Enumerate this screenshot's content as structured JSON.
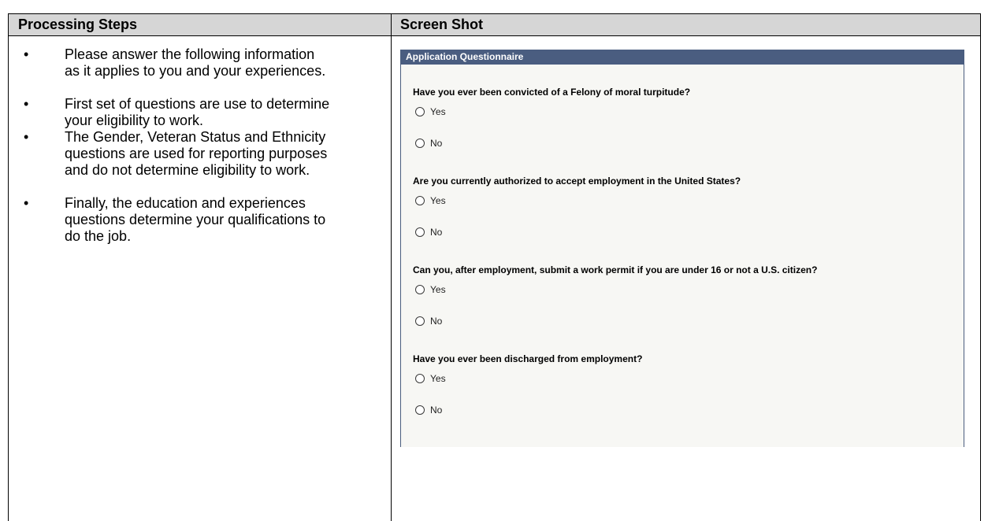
{
  "table": {
    "headers": {
      "left": "Processing Steps",
      "right": "Screen Shot"
    },
    "steps": [
      "Please answer the following information as it applies to you and your experiences.",
      "First set of questions are use to determine your eligibility to work.",
      "The Gender, Veteran Status and Ethnicity questions are used for reporting purposes and do not determine eligibility to work.",
      "Finally, the education and experiences questions determine your qualifications to do the job."
    ],
    "bullet_glyph": "•"
  },
  "questionnaire": {
    "title": "Application Questionnaire",
    "questions": [
      {
        "text": "Have you ever been convicted of a Felony of moral turpitude?",
        "options": [
          "Yes",
          "No"
        ]
      },
      {
        "text": "Are you currently authorized to accept employment in the United States?",
        "options": [
          "Yes",
          "No"
        ]
      },
      {
        "text": "Can you, after employment, submit a work permit if you are under 16 or not a U.S. citizen?",
        "options": [
          "Yes",
          "No"
        ]
      },
      {
        "text": "Have you ever been discharged from employment?",
        "options": [
          "Yes",
          "No"
        ]
      }
    ]
  },
  "colors": {
    "header_bg": "#d6d6d6",
    "panel_title_bg": "#4a5d80",
    "panel_bg": "#f7f7f4"
  }
}
